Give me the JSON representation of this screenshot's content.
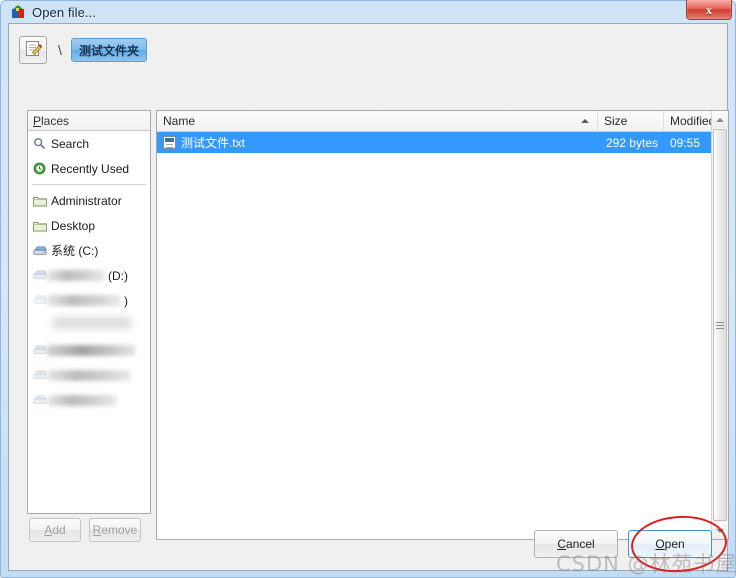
{
  "window": {
    "title": "Open file...",
    "icon": "cube-icon",
    "close_label": "x"
  },
  "pathbar": {
    "create_folder_icon": "edit-folder-icon",
    "separator": "\\",
    "current_folder": "测试文件夹"
  },
  "places": {
    "header": "Places",
    "items": [
      {
        "icon": "search-icon",
        "label": "Search",
        "blurred": false
      },
      {
        "icon": "recent-clock-icon",
        "label": "Recently Used",
        "blurred": false
      },
      {
        "icon": "folder-icon",
        "label": "Administrator",
        "blurred": false
      },
      {
        "icon": "folder-icon",
        "label": "Desktop",
        "blurred": false
      },
      {
        "icon": "drive-icon",
        "label": "系统 (C:)",
        "blurred": false
      },
      {
        "icon": "drive-icon",
        "label": "",
        "tail": "(D:)",
        "blurred": true
      },
      {
        "icon": "drive-icon",
        "label": "",
        "tail": ")",
        "blurred": true
      },
      {
        "icon": "drive-icon",
        "label": "",
        "tail": "",
        "blurred": true
      },
      {
        "icon": "drive-icon",
        "label": "",
        "tail": "",
        "blurred": true
      },
      {
        "icon": "drive-icon",
        "label": "",
        "tail": "",
        "blurred": true
      },
      {
        "icon": "drive-icon",
        "label": "",
        "tail": "",
        "blurred": true
      }
    ],
    "add_label": "Add",
    "add_mnemonic": "A",
    "remove_label": "Remove",
    "remove_mnemonic": "R"
  },
  "filelist": {
    "columns": [
      {
        "key": "name",
        "label": "Name",
        "sorted": "asc"
      },
      {
        "key": "size",
        "label": "Size",
        "sorted": ""
      },
      {
        "key": "modified",
        "label": "Modified",
        "sorted": ""
      }
    ],
    "rows": [
      {
        "icon": "text-file-icon",
        "name": "测试文件.txt",
        "size": "292 bytes",
        "modified": "09:55",
        "selected": true
      }
    ],
    "scrollbar": {
      "up_arrow": "▲",
      "down_arrow": "▼"
    }
  },
  "actions": {
    "cancel_label": "Cancel",
    "cancel_mnemonic": "C",
    "open_label": "Open",
    "open_mnemonic": "O"
  },
  "annotations": {
    "highlight_shape": "red-ellipse",
    "highlight_color": "#e01b1b",
    "watermark": "CSDN @林苑书屋"
  },
  "colors": {
    "selection": "#3399ff",
    "title_gradient_top": "#cfe3f7",
    "close_button": "#d03c2f",
    "crumb_active": "#7fbcee"
  }
}
